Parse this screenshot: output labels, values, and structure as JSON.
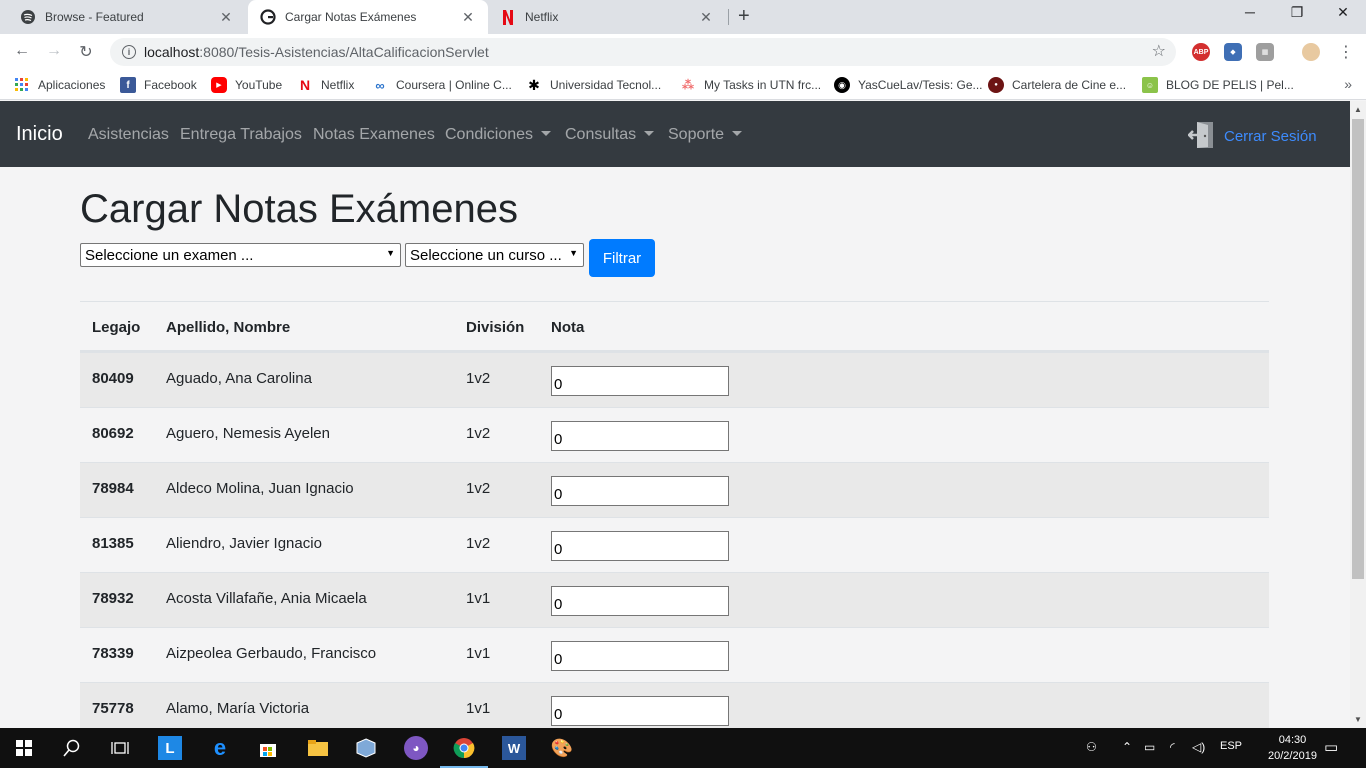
{
  "browser": {
    "tabs": [
      {
        "title": "Browse - Featured",
        "icon": "spotify-icon",
        "active": false
      },
      {
        "title": "Cargar Notas Exámenes",
        "icon": "page-icon",
        "active": true
      },
      {
        "title": "Netflix",
        "icon": "netflix-icon",
        "active": false
      }
    ],
    "address": {
      "host": "localhost",
      "path": ":8080/Tesis-Asistencias/AltaCalificacionServlet"
    },
    "bookmarks": [
      {
        "label": "Aplicaciones",
        "icon": "apps-grid-icon",
        "color": "#4285f4"
      },
      {
        "label": "Facebook",
        "icon": "facebook-icon",
        "color": "#3b5998"
      },
      {
        "label": "YouTube",
        "icon": "youtube-icon",
        "color": "#ff0000"
      },
      {
        "label": "Netflix",
        "icon": "netflix-icon",
        "color": "#e50914"
      },
      {
        "label": "Coursera | Online C...",
        "icon": "coursera-icon",
        "color": "#2a73cc"
      },
      {
        "label": "Universidad Tecnol...",
        "icon": "utn-icon",
        "color": "#000000"
      },
      {
        "label": "My Tasks in UTN frc...",
        "icon": "asana-icon",
        "color": "#f06a6a"
      },
      {
        "label": "YasCueLav/Tesis: Ge...",
        "icon": "github-icon",
        "color": "#000000"
      },
      {
        "label": "Cartelera de Cine e...",
        "icon": "cinema-icon",
        "color": "#6d1414"
      },
      {
        "label": "BLOG DE PELIS | Pel...",
        "icon": "blog-icon",
        "color": "#8bc34a"
      }
    ]
  },
  "nav": {
    "brand": "Inicio",
    "links": [
      {
        "label": "Asistencias",
        "dropdown": false
      },
      {
        "label": "Entrega Trabajos",
        "dropdown": false
      },
      {
        "label": "Notas Examenes",
        "dropdown": false
      },
      {
        "label": "Condiciones",
        "dropdown": true
      },
      {
        "label": "Consultas",
        "dropdown": true
      },
      {
        "label": "Soporte",
        "dropdown": true
      }
    ],
    "logout": "Cerrar Sesión"
  },
  "page": {
    "title": "Cargar Notas Exámenes",
    "exam_select": "Seleccione un examen ...",
    "course_select": "Seleccione un curso ...",
    "filter_button": "Filtrar"
  },
  "table": {
    "headers": [
      "Legajo",
      "Apellido, Nombre",
      "División",
      "Nota"
    ],
    "rows": [
      {
        "legajo": "80409",
        "nombre": "Aguado, Ana Carolina",
        "division": "1v2",
        "nota": "0"
      },
      {
        "legajo": "80692",
        "nombre": "Aguero, Nemesis Ayelen",
        "division": "1v2",
        "nota": "0"
      },
      {
        "legajo": "78984",
        "nombre": "Aldeco Molina, Juan Ignacio",
        "division": "1v2",
        "nota": "0"
      },
      {
        "legajo": "81385",
        "nombre": "Aliendro, Javier Ignacio",
        "division": "1v2",
        "nota": "0"
      },
      {
        "legajo": "78932",
        "nombre": "Acosta Villafañe, Ania Micaela",
        "division": "1v1",
        "nota": "0"
      },
      {
        "legajo": "78339",
        "nombre": "Aizpeolea Gerbaudo, Francisco",
        "division": "1v1",
        "nota": "0"
      },
      {
        "legajo": "75778",
        "nombre": "Alamo, María Victoria",
        "division": "1v1",
        "nota": "0"
      }
    ]
  },
  "taskbar": {
    "language": "ESP",
    "time": "04:30",
    "date": "20/2/2019"
  },
  "colors": {
    "primary": "#007bff",
    "navbar": "#343a40",
    "logout_link": "#3d8bfd"
  }
}
